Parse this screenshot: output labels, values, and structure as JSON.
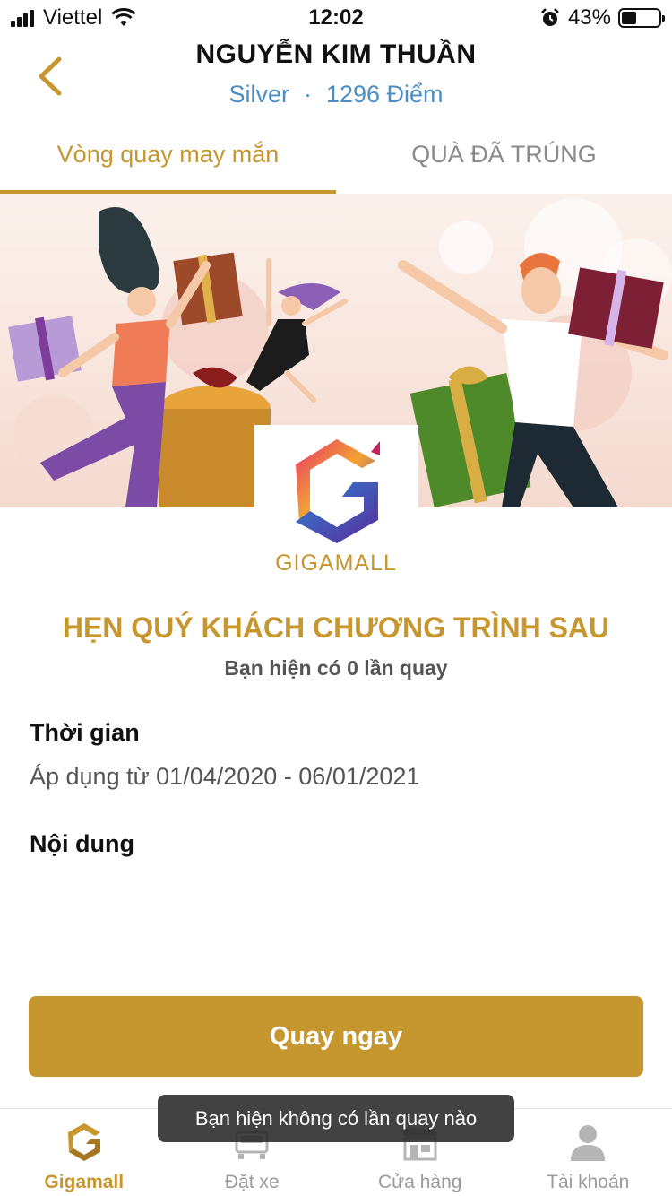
{
  "status_bar": {
    "carrier": "Viettel",
    "time": "12:02",
    "battery": "43%"
  },
  "header": {
    "title": "NGUYỄN KIM THUẦN",
    "tier": "Silver",
    "separator": "·",
    "points": "1296 Điểm"
  },
  "tabs": [
    {
      "label": "Vòng quay may mắn",
      "active": true
    },
    {
      "label": "QUÀ ĐÃ TRÚNG",
      "active": false
    }
  ],
  "brand": {
    "name": "GIGAMALL"
  },
  "campaign": {
    "headline": "HẸN QUÝ KHÁCH CHƯƠNG TRÌNH SAU",
    "spins_text": "Bạn hiện có 0 lần quay"
  },
  "time_section": {
    "title": "Thời gian",
    "text": "Áp dụng từ 01/04/2020 - 06/01/2021"
  },
  "content_section": {
    "title": "Nội dung"
  },
  "cta": {
    "label": "Quay ngay"
  },
  "toast": {
    "text": "Bạn hiện không có lần quay nào"
  },
  "bottom_nav": [
    {
      "label": "Gigamall",
      "icon": "gigamall-icon",
      "active": true
    },
    {
      "label": "Đặt xe",
      "icon": "car-icon",
      "active": false
    },
    {
      "label": "Cửa hàng",
      "icon": "store-icon",
      "active": false
    },
    {
      "label": "Tài khoản",
      "icon": "user-icon",
      "active": false
    }
  ],
  "colors": {
    "accent": "#c6962f",
    "link": "#4a8ec4"
  }
}
